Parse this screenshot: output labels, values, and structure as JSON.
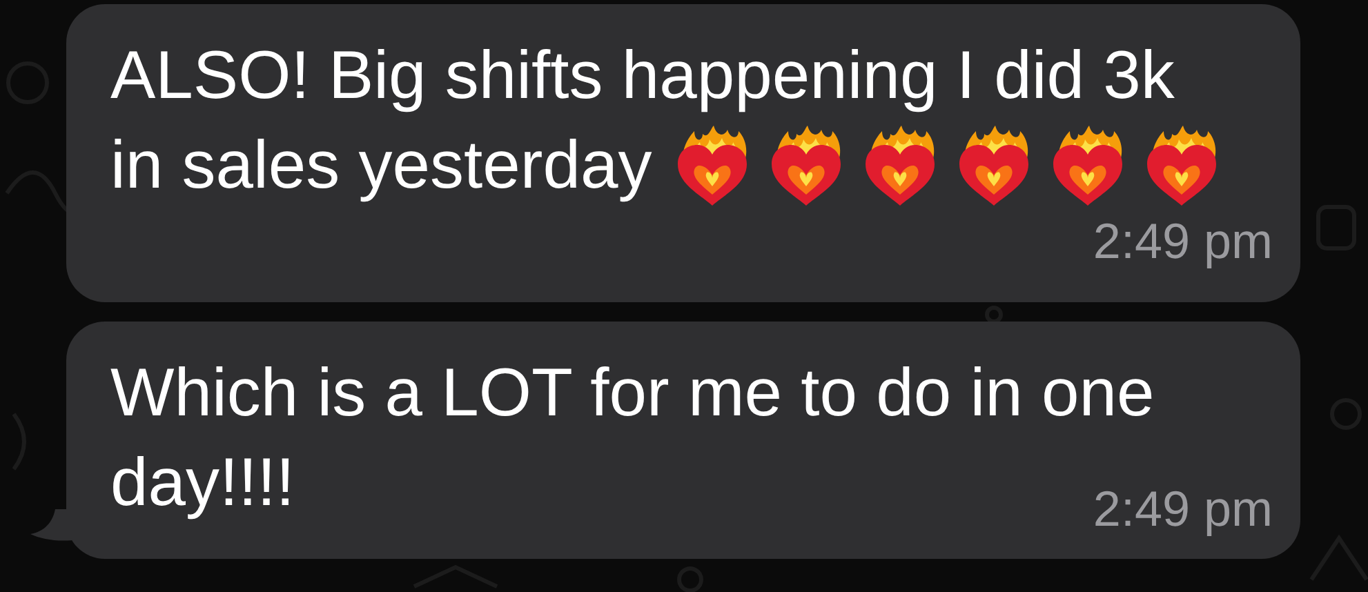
{
  "messages": [
    {
      "lines": [
        "ALSO! Big shifts happening I did 3k",
        "in sales yesterday"
      ],
      "icons": [
        {
          "kind": "heart-on-fire"
        },
        {
          "kind": "heart-on-fire"
        },
        {
          "kind": "heart-on-fire"
        },
        {
          "kind": "heart-on-fire"
        },
        {
          "kind": "heart-on-fire"
        },
        {
          "kind": "heart-on-fire"
        }
      ],
      "time": "2:49 pm",
      "tail": false
    },
    {
      "lines": [
        "Which is a LOT for me to do in one",
        "day!!!!"
      ],
      "time": "2:49 pm",
      "tail": true
    }
  ]
}
